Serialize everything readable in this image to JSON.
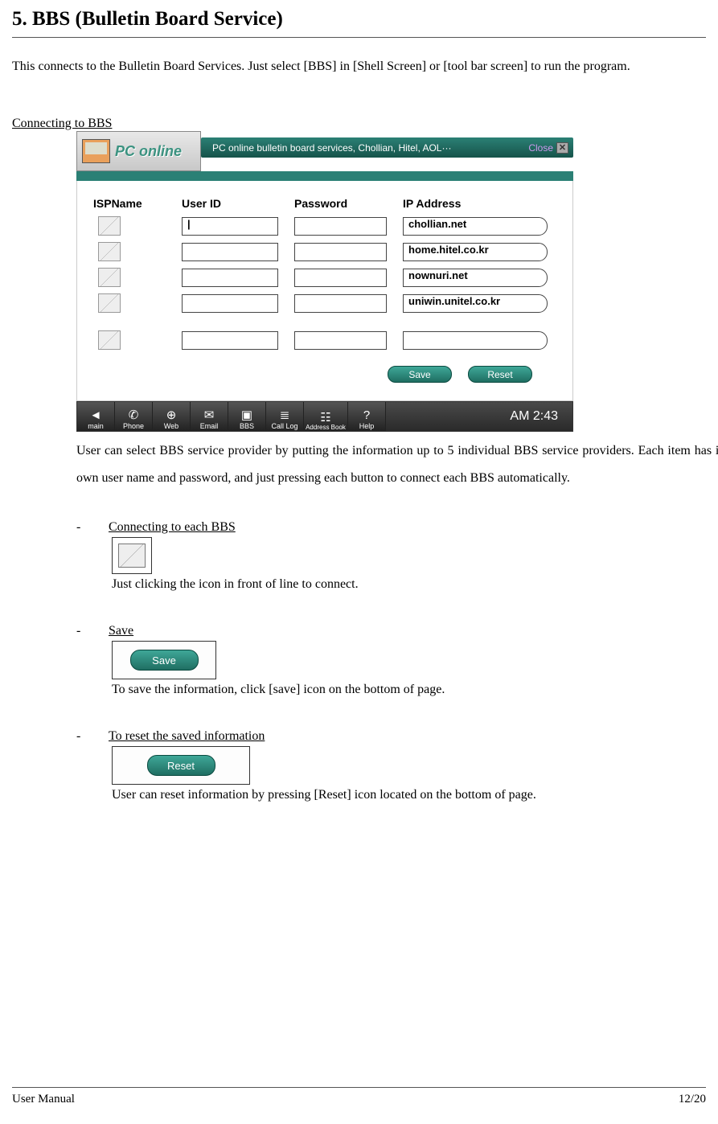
{
  "section": {
    "title": "5.   BBS (Bulletin Board Service)",
    "intro": "This connects to the Bulletin Board Services. Just select [BBS] in [Shell Screen] or [tool bar screen] to run the program.",
    "subtitle": "Connecting to BBS"
  },
  "app": {
    "logo_text": "PC online",
    "subtitle": "PC online bulletin board services, Chollian, Hitel, AOL···",
    "close_label": "Close",
    "headers": {
      "isp": "ISPName",
      "uid": "User ID",
      "pwd": "Password",
      "ip": "IP Address"
    },
    "rows": [
      {
        "uid": "|",
        "pwd": "",
        "ip": "chollian.net"
      },
      {
        "uid": "",
        "pwd": "",
        "ip": "home.hitel.co.kr"
      },
      {
        "uid": "",
        "pwd": "",
        "ip": "nownuri.net"
      },
      {
        "uid": "",
        "pwd": "",
        "ip": "uniwin.unitel.co.kr"
      },
      {
        "uid": "",
        "pwd": "",
        "ip": ""
      }
    ],
    "save_btn": "Save",
    "reset_btn": "Reset",
    "toolbar": [
      {
        "icon": "◄",
        "label": "main"
      },
      {
        "icon": "✆",
        "label": "Phone"
      },
      {
        "icon": "⊕",
        "label": "Web"
      },
      {
        "icon": "✉",
        "label": "Email"
      },
      {
        "icon": "▣",
        "label": "BBS"
      },
      {
        "icon": "≣",
        "label": "Call Log"
      },
      {
        "icon": "☷",
        "label": "Address Book"
      },
      {
        "icon": "?",
        "label": "Help"
      }
    ],
    "clock": "AM 2:43"
  },
  "desc": "User can select BBS service provider by putting the information up to 5 individual BBS service providers. Each item has its own user name and password, and just pressing each button to connect each BBS automatically.",
  "bullets": {
    "connect": {
      "label": "Connecting to each BBS",
      "text": "Just clicking the icon in front of line to connect."
    },
    "save": {
      "label": "Save",
      "btn": "Save",
      "text": "To save the information, click [save] icon on the bottom of page."
    },
    "reset": {
      "label": "To reset the saved information",
      "btn": "Reset",
      "text": "User can reset information by pressing [Reset] icon located on the bottom of page."
    }
  },
  "footer": {
    "left": "User  Manual",
    "right": "12/20"
  }
}
